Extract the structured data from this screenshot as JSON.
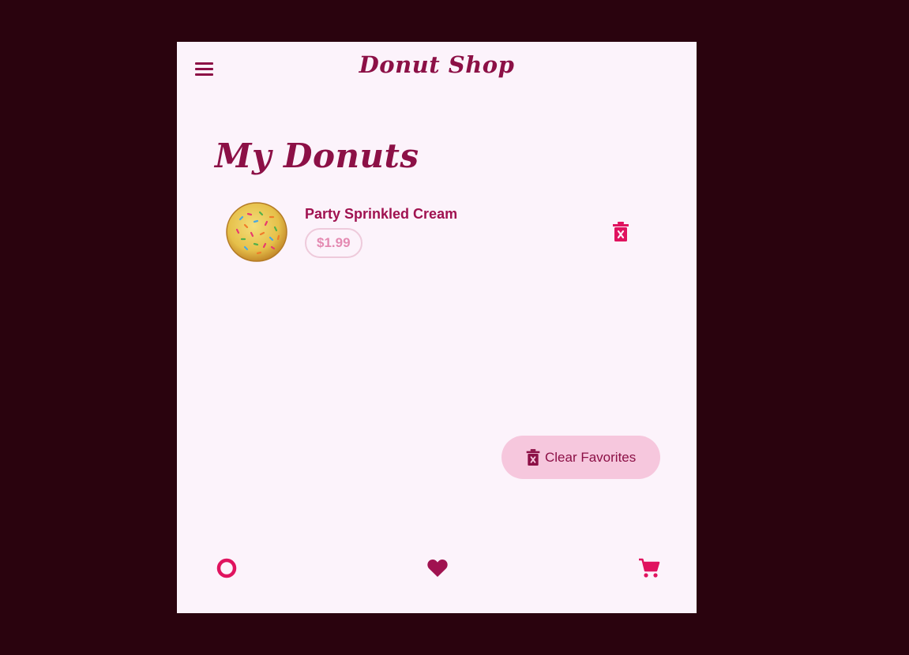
{
  "app": {
    "title": "Donut Shop"
  },
  "header": {
    "menu_icon": "menu-icon"
  },
  "page": {
    "title": "My Donuts"
  },
  "favorites": [
    {
      "name": "Party Sprinkled Cream",
      "price": "$1.99",
      "image": "sprinkled-donut",
      "action_icon": "delete-icon"
    }
  ],
  "fab": {
    "label": "Clear Favorites",
    "icon": "delete-icon"
  },
  "bottom_nav": [
    {
      "icon": "donut-icon"
    },
    {
      "icon": "heart-icon",
      "selected": true
    },
    {
      "icon": "cart-icon"
    }
  ],
  "colors": {
    "background": "#2a030e",
    "surface": "#fcf3fb",
    "primary": "#8c1046",
    "accent": "#e0135f",
    "chip_border": "#eecadb",
    "chip_text": "#e48ab2",
    "fab_bg": "#f6c7dd"
  }
}
